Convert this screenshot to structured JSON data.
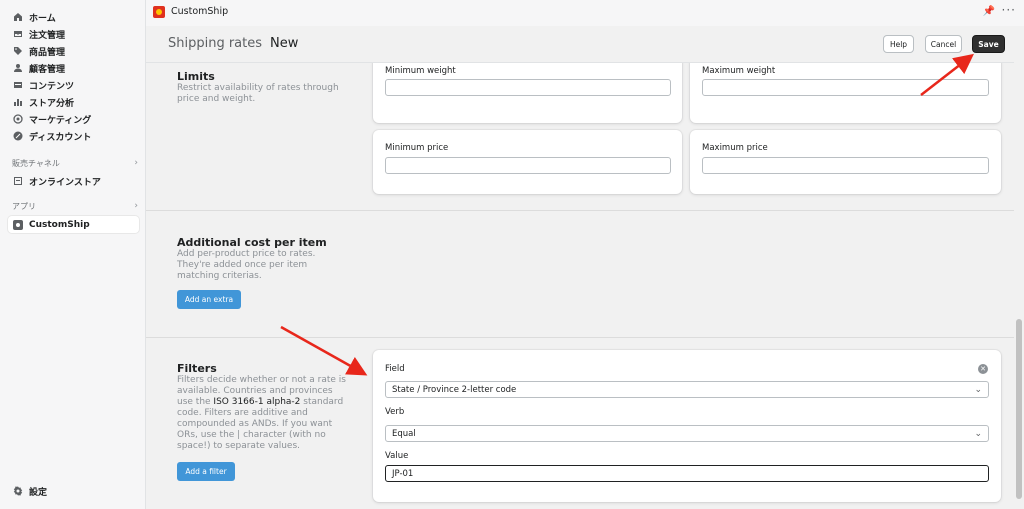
{
  "sidebar": {
    "items": [
      {
        "label": "ホーム",
        "icon": "home-icon"
      },
      {
        "label": "注文管理",
        "icon": "inbox-icon"
      },
      {
        "label": "商品管理",
        "icon": "tag-icon"
      },
      {
        "label": "顧客管理",
        "icon": "person-icon"
      },
      {
        "label": "コンテンツ",
        "icon": "document-icon"
      },
      {
        "label": "ストア分析",
        "icon": "bar-chart-icon"
      },
      {
        "label": "マーケティング",
        "icon": "target-icon"
      },
      {
        "label": "ディスカウント",
        "icon": "discount-icon"
      }
    ],
    "sales_channels_label": "販売チャネル",
    "online_store": "オンラインストア",
    "apps_label": "アプリ",
    "app_item": "CustomShip",
    "settings": "設定"
  },
  "topbar": {
    "app_name": "CustomShip"
  },
  "header": {
    "title_main": "Shipping rates",
    "title_sub": "New",
    "help": "Help",
    "cancel": "Cancel",
    "save": "Save"
  },
  "limits": {
    "title": "Limits",
    "desc": "Restrict availability of rates through price and weight.",
    "min_weight": "Minimum weight",
    "max_weight": "Maximum weight",
    "min_price": "Minimum price",
    "max_price": "Maximum price"
  },
  "additional": {
    "title": "Additional cost per item",
    "desc": "Add per-product price to rates. They're added once per item matching criterias.",
    "button": "Add an extra"
  },
  "filters": {
    "title": "Filters",
    "desc_1": "Filters decide whether or not a rate is available. Countries and provinces use the ",
    "desc_code": "ISO 3166-1 alpha-2",
    "desc_2": " standard code. Filters are additive and compounded as ANDs. If you want ORs, use the | character (with no space!) to separate values.",
    "button": "Add a filter",
    "field_label": "Field",
    "field_value": "State / Province 2-letter code",
    "verb_label": "Verb",
    "verb_value": "Equal",
    "value_label": "Value",
    "value_value": "JP-01"
  },
  "colors": {
    "accent": "#4196d8",
    "annotation": "#e8271b",
    "save": "#303030"
  }
}
